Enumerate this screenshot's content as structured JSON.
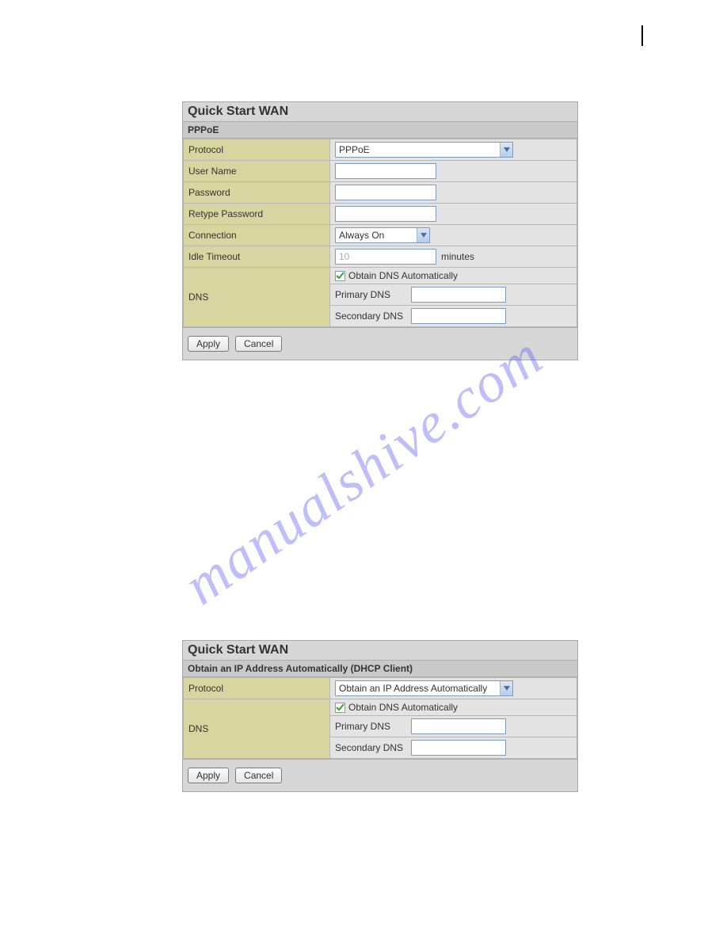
{
  "watermark": "manualshive.com",
  "panel1": {
    "title": "Quick Start WAN",
    "subtitle": "PPPoE",
    "rows": {
      "protocol_label": "Protocol",
      "protocol_value": "PPPoE",
      "username_label": "User Name",
      "username_value": "",
      "password_label": "Password",
      "password_value": "",
      "retype_label": "Retype Password",
      "retype_value": "",
      "connection_label": "Connection",
      "connection_value": "Always On",
      "idle_label": "Idle Timeout",
      "idle_value": "10",
      "idle_suffix": "minutes",
      "dns_label": "DNS",
      "obtain_dns_label": "Obtain DNS Automatically",
      "primary_dns_label": "Primary DNS",
      "primary_dns_value": "",
      "secondary_dns_label": "Secondary DNS",
      "secondary_dns_value": ""
    },
    "apply": "Apply",
    "cancel": "Cancel"
  },
  "panel2": {
    "title": "Quick Start WAN",
    "subtitle": "Obtain an IP Address Automatically (DHCP Client)",
    "rows": {
      "protocol_label": "Protocol",
      "protocol_value": "Obtain an IP Address Automatically",
      "dns_label": "DNS",
      "obtain_dns_label": "Obtain DNS Automatically",
      "primary_dns_label": "Primary DNS",
      "primary_dns_value": "",
      "secondary_dns_label": "Secondary DNS",
      "secondary_dns_value": ""
    },
    "apply": "Apply",
    "cancel": "Cancel"
  }
}
